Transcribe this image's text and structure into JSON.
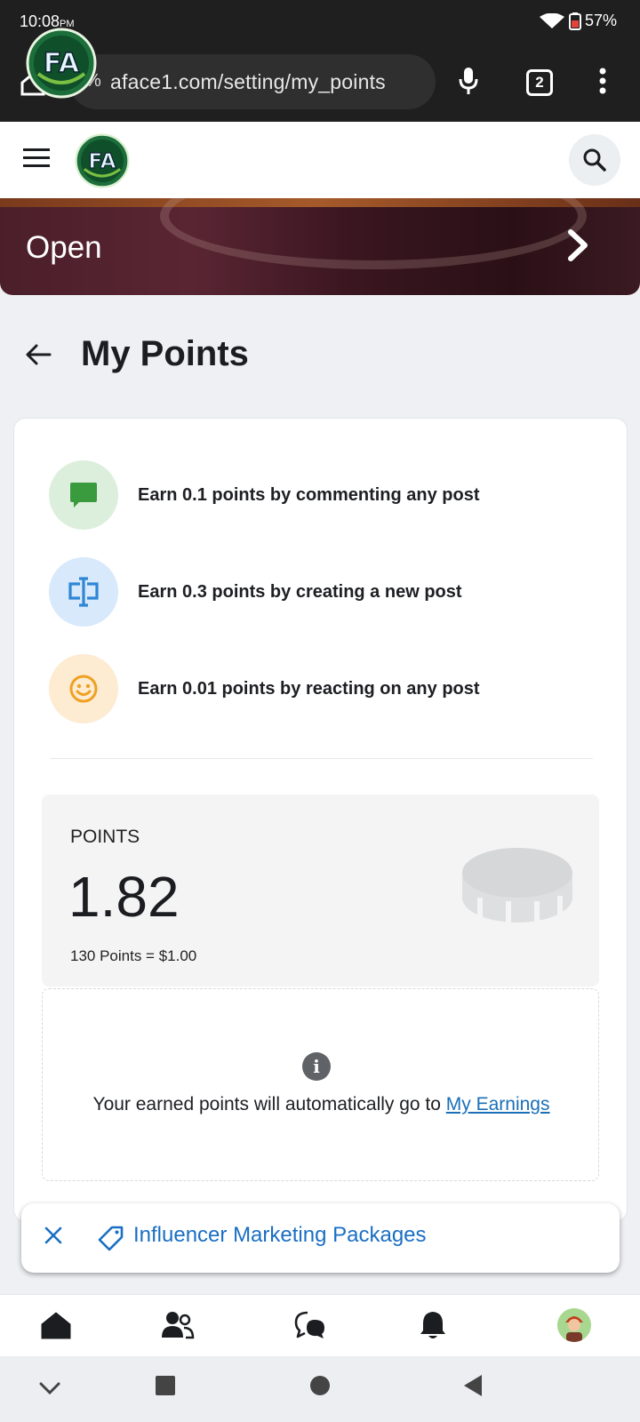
{
  "status_bar": {
    "time": "10:08",
    "ampm": "PM",
    "battery": "57%"
  },
  "browser": {
    "url": "aface1.com/setting/my_points",
    "tab_count": "2"
  },
  "header": {
    "logo_text": "FA"
  },
  "banner": {
    "label": "Open"
  },
  "page": {
    "title": "My Points"
  },
  "earn_rules": [
    {
      "text": "Earn 0.1 points by commenting any post",
      "icon": "comment-icon",
      "bg": "#dcefdc",
      "color": "#3a9a3e"
    },
    {
      "text": "Earn 0.3 points by creating a new post",
      "icon": "create-post-icon",
      "bg": "#d7e9fa",
      "color": "#2f86d6"
    },
    {
      "text": "Earn 0.01 points by reacting on any post",
      "icon": "smiley-icon",
      "bg": "#fdebd2",
      "color": "#f0a020"
    }
  ],
  "points": {
    "label": "POINTS",
    "value": "1.82",
    "rate": "130 Points = $1.00"
  },
  "info": {
    "text": "Your earned points will automatically go to ",
    "link": "My Earnings"
  },
  "toast": {
    "text": "Influencer Marketing Packages"
  },
  "bottom_nav": [
    "home-icon",
    "friends-icon",
    "chat-icon",
    "bell-icon",
    "avatar"
  ],
  "colors": {
    "link_blue": "#1a6fb8",
    "toast_blue": "#1a6fc4",
    "chrome_dark": "#1f1f1f"
  }
}
